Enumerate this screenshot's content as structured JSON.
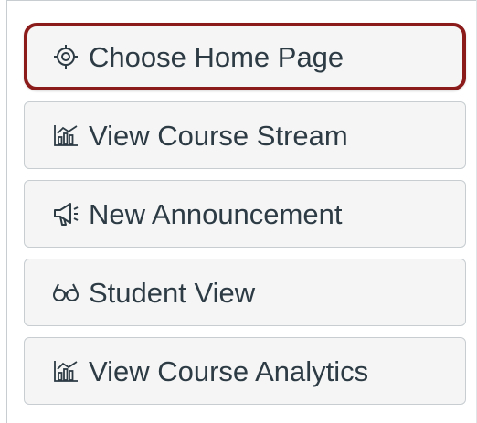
{
  "sidebar": {
    "buttons": [
      {
        "label": "Choose Home Page",
        "icon": "target-icon",
        "highlighted": true
      },
      {
        "label": "View Course Stream",
        "icon": "bar-chart-icon"
      },
      {
        "label": "New Announcement",
        "icon": "megaphone-icon"
      },
      {
        "label": "Student View",
        "icon": "glasses-icon"
      },
      {
        "label": "View Course Analytics",
        "icon": "bar-chart-icon"
      }
    ]
  },
  "colors": {
    "highlight_border": "#8b1a1a",
    "button_bg": "#f5f5f5",
    "button_border": "#c7cdd1",
    "text": "#2d3b45"
  }
}
